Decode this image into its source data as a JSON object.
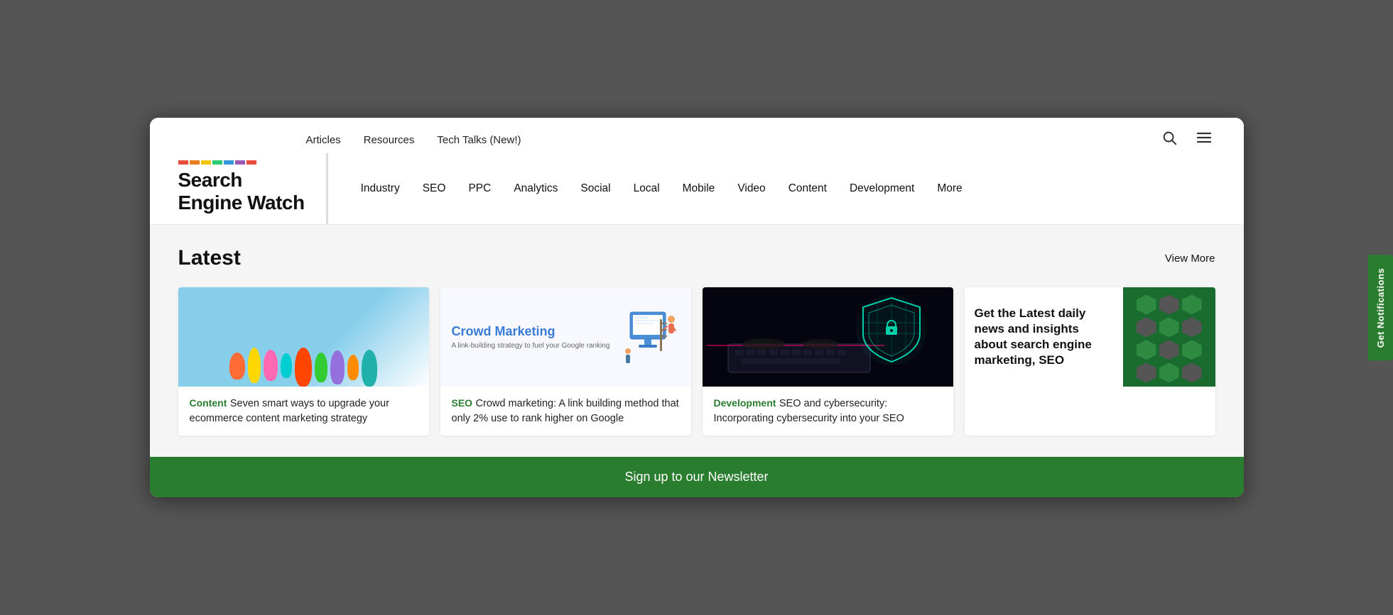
{
  "site": {
    "name": "Search Engine Watch",
    "logo_line1": "Search",
    "logo_line2": "Engine Watch"
  },
  "colors": {
    "accent": "#2a7d2e",
    "bar": [
      "#e74c3c",
      "#f39c12",
      "#27ae60",
      "#2980b9",
      "#8e44ad",
      "#e74c3c"
    ]
  },
  "top_nav": {
    "links": [
      "Articles",
      "Resources",
      "Tech Talks (New!)"
    ]
  },
  "main_nav": {
    "links": [
      "Industry",
      "SEO",
      "PPC",
      "Analytics",
      "Social",
      "Local",
      "Mobile",
      "Video",
      "Content",
      "Development",
      "More"
    ]
  },
  "latest_section": {
    "title": "Latest",
    "view_more": "View More"
  },
  "cards": [
    {
      "category": "Content",
      "category_class": "cat-content",
      "title": "Seven smart ways to upgrade your ecommerce content marketing strategy",
      "image_type": "rocks"
    },
    {
      "category": "SEO",
      "category_class": "cat-seo",
      "title": "Crowd marketing: A link building method that only 2% use to rank higher on Google",
      "image_type": "crowd-marketing",
      "headline": "Crowd Marketing",
      "subtext": "A link-building strategy to fuel your Google ranking"
    },
    {
      "category": "Development",
      "category_class": "cat-development",
      "title": "SEO and cybersecurity: Incorporating cybersecurity into your SEO",
      "image_type": "cybersecurity"
    },
    {
      "category": "",
      "category_class": "",
      "title": "",
      "image_type": "newsletter-promo",
      "promo_text": "Get the Latest daily news and insights about search engine marketing, SEO"
    }
  ],
  "newsletter": {
    "label": "Sign up to our Newsletter"
  },
  "notifications": {
    "label": "Get Notifications"
  },
  "icons": {
    "search": "🔍",
    "menu": "☰"
  }
}
